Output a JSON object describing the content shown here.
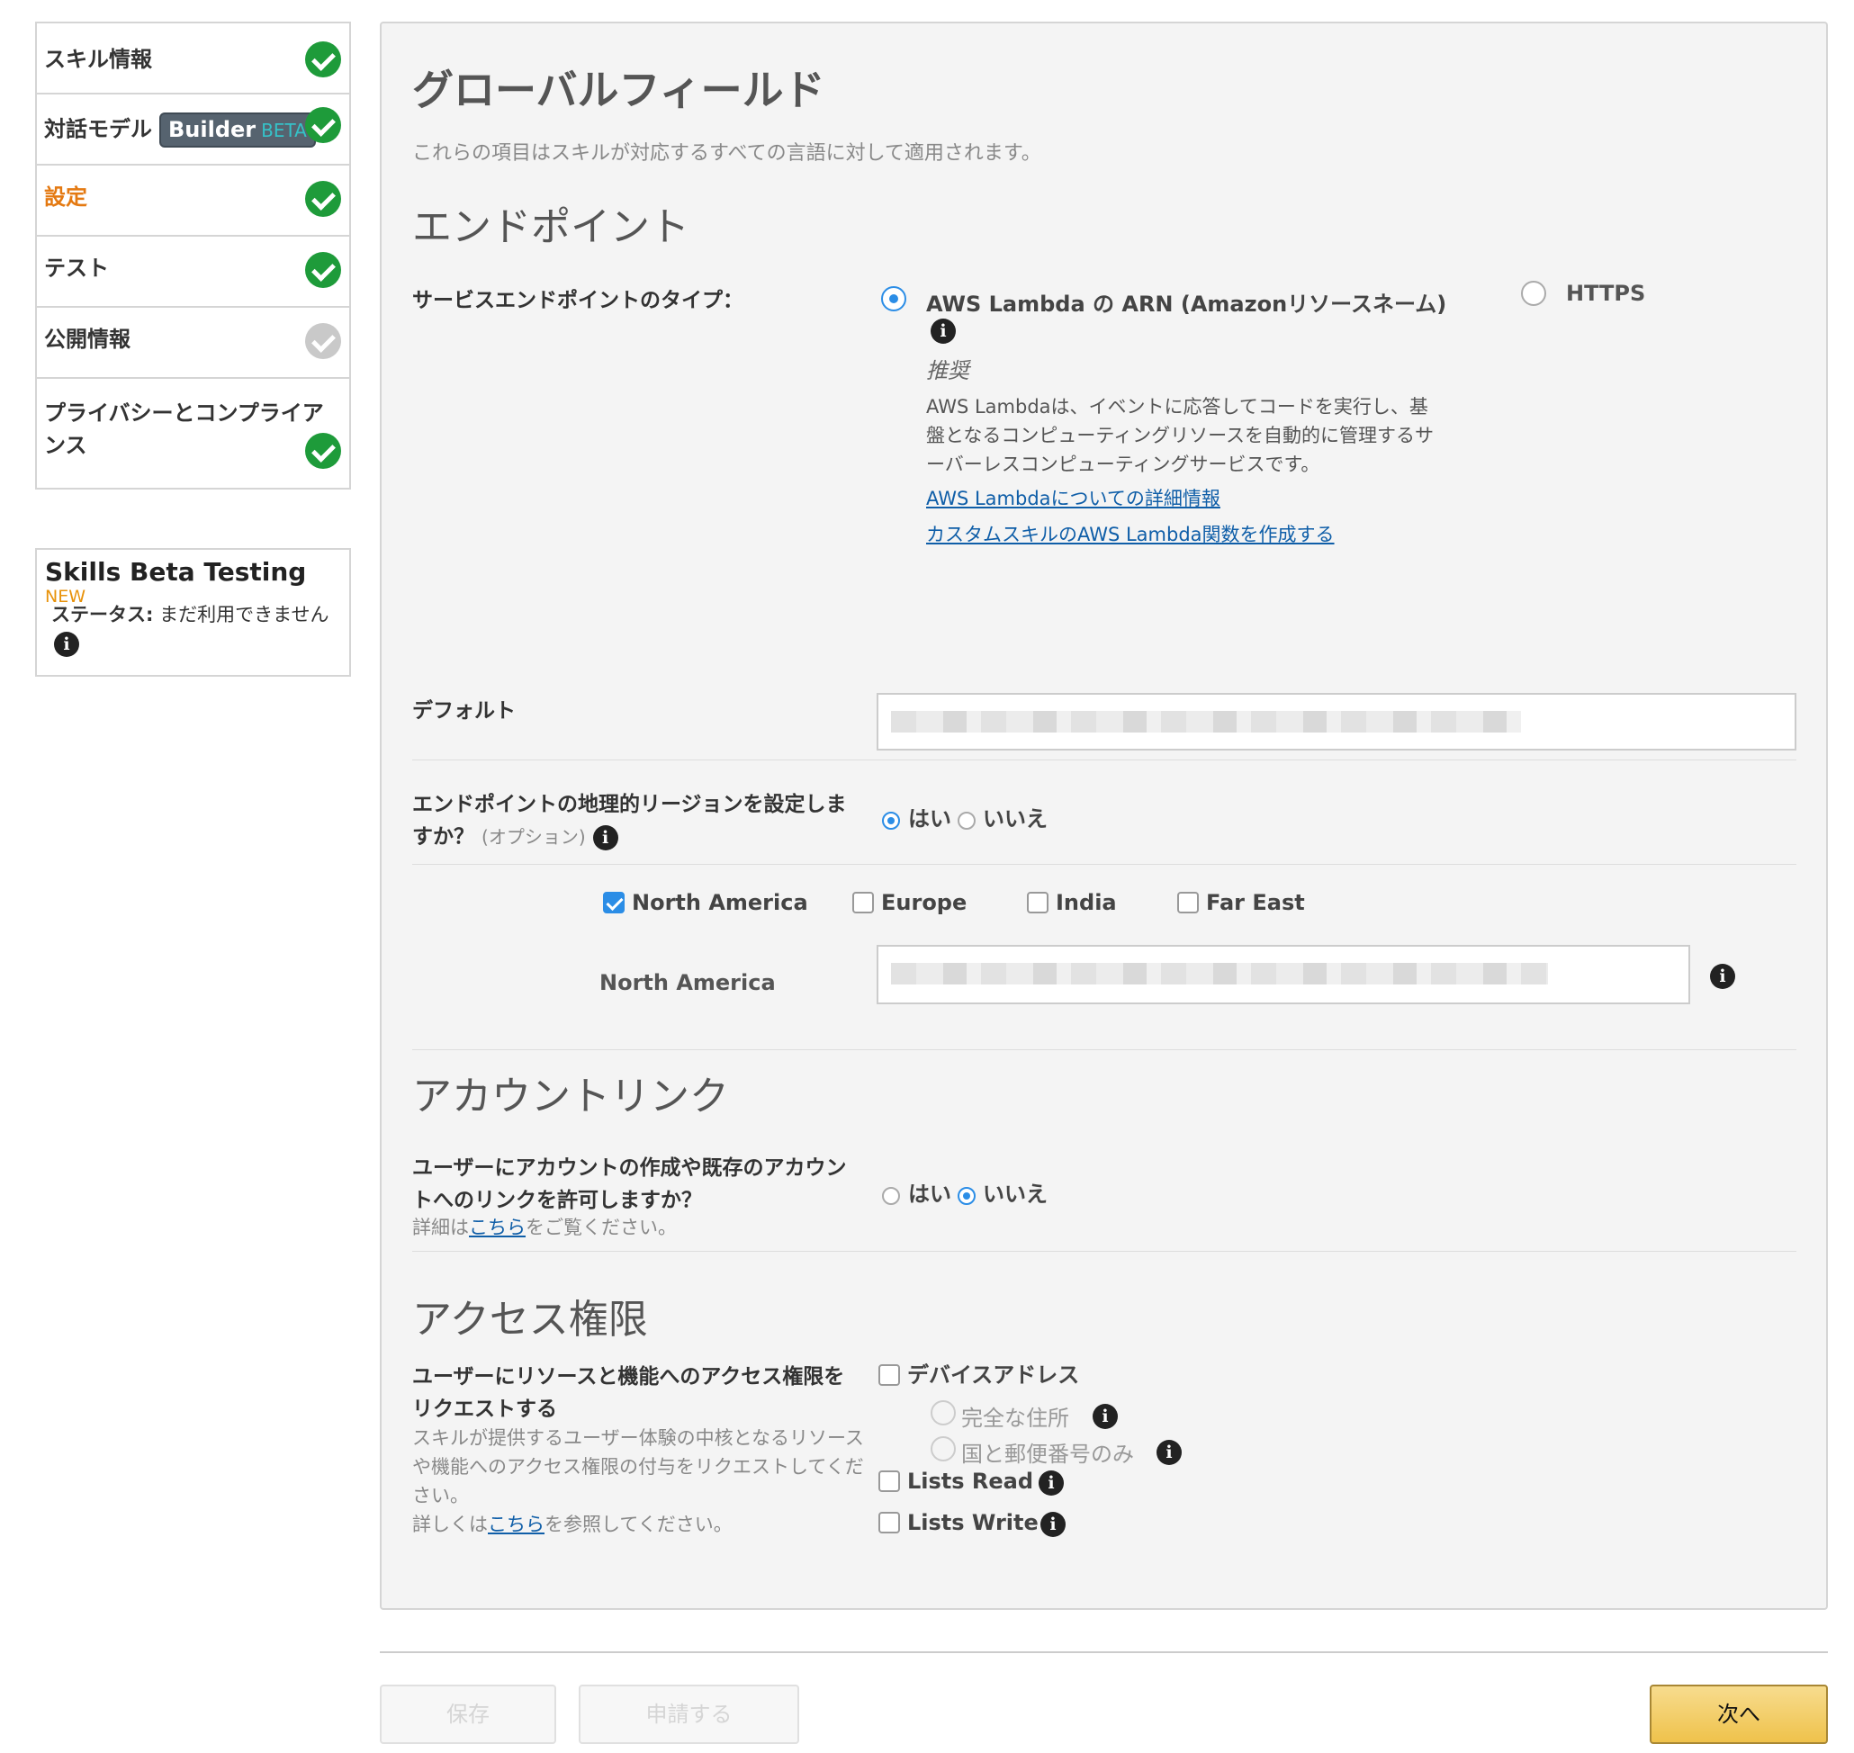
{
  "sidebar": {
    "items": [
      {
        "label": "スキル情報"
      },
      {
        "label": "対話モデル",
        "badge": "Builder",
        "badge_tag": "BETA"
      },
      {
        "label": "設定"
      },
      {
        "label": "テスト"
      },
      {
        "label": "公開情報"
      },
      {
        "label": "プライバシーとコンプライアンス"
      }
    ],
    "beta": {
      "title": "Skills Beta Testing",
      "new_tag": "NEW",
      "status_label": "ステータス:",
      "status_value": "まだ利用できません"
    }
  },
  "main": {
    "title": "グローバルフィールド",
    "subtitle": "これらの項目はスキルが対応するすべての言語に対して適用されます。",
    "endpoint": {
      "heading": "エンドポイント",
      "type_label": "サービスエンドポイントのタイプ：",
      "lambda_label": "AWS Lambda の ARN (Amazonリソースネーム)",
      "recommended": "推奨",
      "description": "AWS Lambdaは、イベントに応答してコードを実行し、基盤となるコンピューティングリソースを自動的に管理するサーバーレスコンピューティングサービスです。",
      "link1": "AWS Lambdaについての詳細情報",
      "link2": "カスタムスキルのAWS Lambda関数を作成する",
      "https_label": "HTTPS",
      "default_label": "デフォルト",
      "region_question": "エンドポイントの地理的リージョンを設定しますか？",
      "region_optional": "(オプション)",
      "yes": "はい",
      "no": "いいえ",
      "regions": [
        "North America",
        "Europe",
        "India",
        "Far East"
      ],
      "na_label": "North America"
    },
    "account": {
      "heading": "アカウントリンク",
      "question": "ユーザーにアカウントの作成や既存のアカウントへのリンクを許可しますか？",
      "details_pre": "詳細は",
      "details_link": "こちら",
      "details_post": "をご覧ください。",
      "yes": "はい",
      "no": "いいえ"
    },
    "permissions": {
      "heading": "アクセス権限",
      "label": "ユーザーにリソースと機能へのアクセス権限をリクエストする",
      "desc": "スキルが提供するユーザー体験の中核となるリソースや機能へのアクセス権限の付与をリクエストしてください。",
      "more_pre": "詳しくは",
      "more_link": "こちら",
      "more_post": "を参照してください。",
      "device_address": "デバイスアドレス",
      "full_address": "完全な住所",
      "country_postal": "国と郵便番号のみ",
      "lists_read": "Lists Read",
      "lists_write": "Lists Write"
    }
  },
  "footer": {
    "save": "保存",
    "submit": "申請する",
    "next": "次へ"
  }
}
